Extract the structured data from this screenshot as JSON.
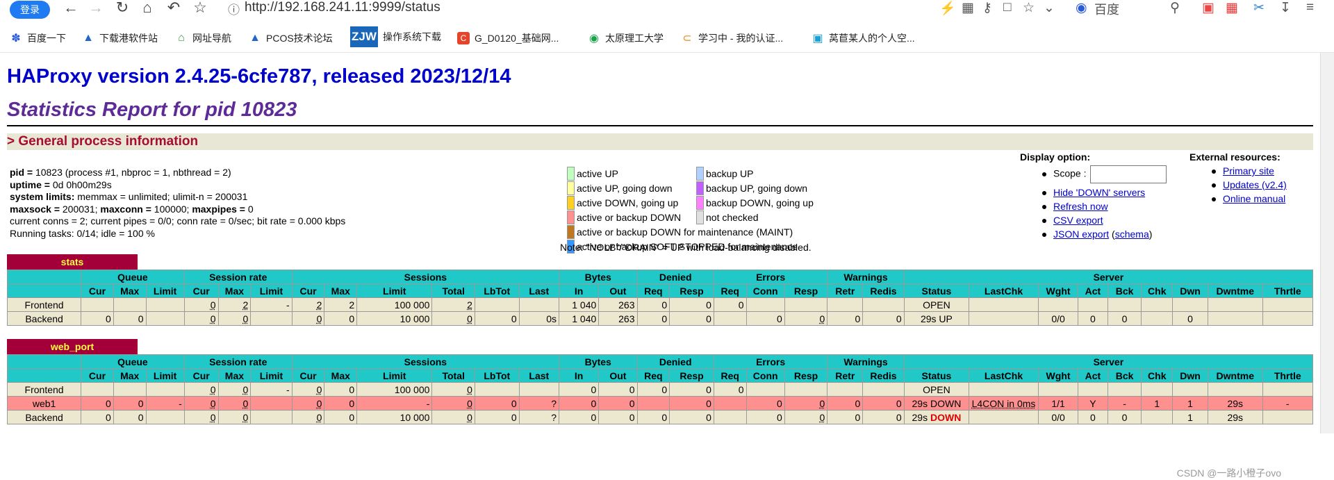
{
  "browser": {
    "login_label": "登录",
    "url": "http://192.168.241.11:9999/status",
    "search_engine": "百度",
    "bookmarks": [
      "百度一下",
      "下载港软件站",
      "网址导航",
      "PCOS技术论坛",
      "操作系统下载",
      "G_D0120_基础网...",
      "太原理工大学",
      "学习中 - 我的认证...",
      "莴苣某人的个人空..."
    ],
    "zjw_badge": "ZJW"
  },
  "page": {
    "version_title": "HAProxy version 2.4.25-6cfe787, released 2023/12/14",
    "stats_title": "Statistics Report for pid 10823",
    "section_general": "> General process information",
    "process": [
      {
        "key": "pid =",
        "val": " 10823 (process #1, nbproc = 1, nbthread = 2)"
      },
      {
        "key": "uptime =",
        "val": " 0d 0h00m29s"
      },
      {
        "key": "system limits:",
        "val": " memmax = unlimited; ulimit-n = 200031"
      },
      {
        "key": "maxsock =",
        "val": " 200031; ",
        "key2": "maxconn =",
        "val2": " 100000; ",
        "key3": "maxpipes =",
        "val3": " 0"
      },
      {
        "key": "",
        "val": "current conns = 2; current pipes = 0/0; conn rate = 0/sec; bit rate = 0.000 kbps"
      },
      {
        "key": "",
        "val": "Running tasks: 0/14; idle = 100 %"
      }
    ],
    "legend": [
      {
        "label": "active UP",
        "color": "#c0ffc0"
      },
      {
        "label": "active UP, going down",
        "color": "#ffffa0"
      },
      {
        "label": "active DOWN, going up",
        "color": "#ffd020"
      },
      {
        "label": "active or backup DOWN",
        "color": "#ff9090"
      },
      {
        "label": "active or backup DOWN for maintenance (MAINT)",
        "color": "#c07820"
      },
      {
        "label": "active or backup SOFT STOPPED for maintenance",
        "color": "#3399ff"
      },
      {
        "label": "backup UP",
        "color": "#b0d0ff"
      },
      {
        "label": "backup UP, going down",
        "color": "#c060ff"
      },
      {
        "label": "backup DOWN, going up",
        "color": "#ff80ff"
      },
      {
        "label": "not checked",
        "color": "#e0e0e0"
      }
    ],
    "legend_note": "Note: \"NOLB\"/\"DRAIN\" = UP with load-balancing disabled.",
    "display_option": {
      "title": "Display option:",
      "scope_label": "Scope :",
      "links": [
        "Hide 'DOWN' servers",
        "Refresh now",
        "CSV export",
        "JSON export"
      ],
      "schema_link": "schema"
    },
    "external": {
      "title": "External resources:",
      "links": [
        "Primary site",
        "Updates (v2.4)",
        "Online manual"
      ]
    }
  },
  "stats_table": {
    "name": "stats",
    "groups": [
      "",
      "Queue",
      "Session rate",
      "Sessions",
      "Bytes",
      "Denied",
      "Errors",
      "Warnings",
      "Server"
    ],
    "cols": [
      "",
      "Cur",
      "Max",
      "Limit",
      "Cur",
      "Max",
      "Limit",
      "Cur",
      "Max",
      "Limit",
      "Total",
      "LbTot",
      "Last",
      "In",
      "Out",
      "Req",
      "Resp",
      "Req",
      "Conn",
      "Resp",
      "Retr",
      "Redis",
      "Status",
      "LastChk",
      "Wght",
      "Act",
      "Bck",
      "Chk",
      "Dwn",
      "Dwntme",
      "Thrtle"
    ],
    "rows": [
      [
        "Frontend",
        "",
        "",
        "",
        "0",
        "2",
        "-",
        "2",
        "2",
        "100 000",
        "2",
        "",
        "",
        "1 040",
        "263",
        "0",
        "0",
        "0",
        "",
        "",
        "",
        "",
        "OPEN",
        "",
        "",
        "",
        "",
        "",
        "",
        "",
        ""
      ],
      [
        "Backend",
        "0",
        "0",
        "",
        "0",
        "0",
        "",
        "0",
        "0",
        "10 000",
        "0",
        "0",
        "0s",
        "1 040",
        "263",
        "0",
        "0",
        "",
        "0",
        "0",
        "0",
        "0",
        "29s UP",
        "",
        "0/0",
        "0",
        "0",
        "",
        "0",
        "",
        ""
      ]
    ]
  },
  "web_table": {
    "name": "web_port",
    "rows": [
      [
        "Frontend",
        "",
        "",
        "",
        "0",
        "0",
        "-",
        "0",
        "0",
        "100 000",
        "0",
        "",
        "",
        "0",
        "0",
        "0",
        "0",
        "0",
        "",
        "",
        "",
        "",
        "OPEN",
        "",
        "",
        "",
        "",
        "",
        "",
        "",
        ""
      ],
      [
        "web1",
        "0",
        "0",
        "-",
        "0",
        "0",
        "",
        "0",
        "0",
        "-",
        "0",
        "0",
        "?",
        "0",
        "0",
        "",
        "0",
        "",
        "0",
        "0",
        "0",
        "0",
        "29s DOWN",
        "L4CON in 0ms",
        "1/1",
        "Y",
        "-",
        "1",
        "1",
        "29s",
        "-"
      ],
      [
        "Backend",
        "0",
        "0",
        "",
        "0",
        "0",
        "",
        "0",
        "0",
        "10 000",
        "0",
        "0",
        "?",
        "0",
        "0",
        "0",
        "0",
        "",
        "0",
        "0",
        "0",
        "0",
        "29s ",
        "",
        "0/0",
        "0",
        "0",
        "",
        "1",
        "29s",
        ""
      ]
    ],
    "backend_status_down": "DOWN"
  },
  "watermark": "CSDN @一路小橙子ovo"
}
